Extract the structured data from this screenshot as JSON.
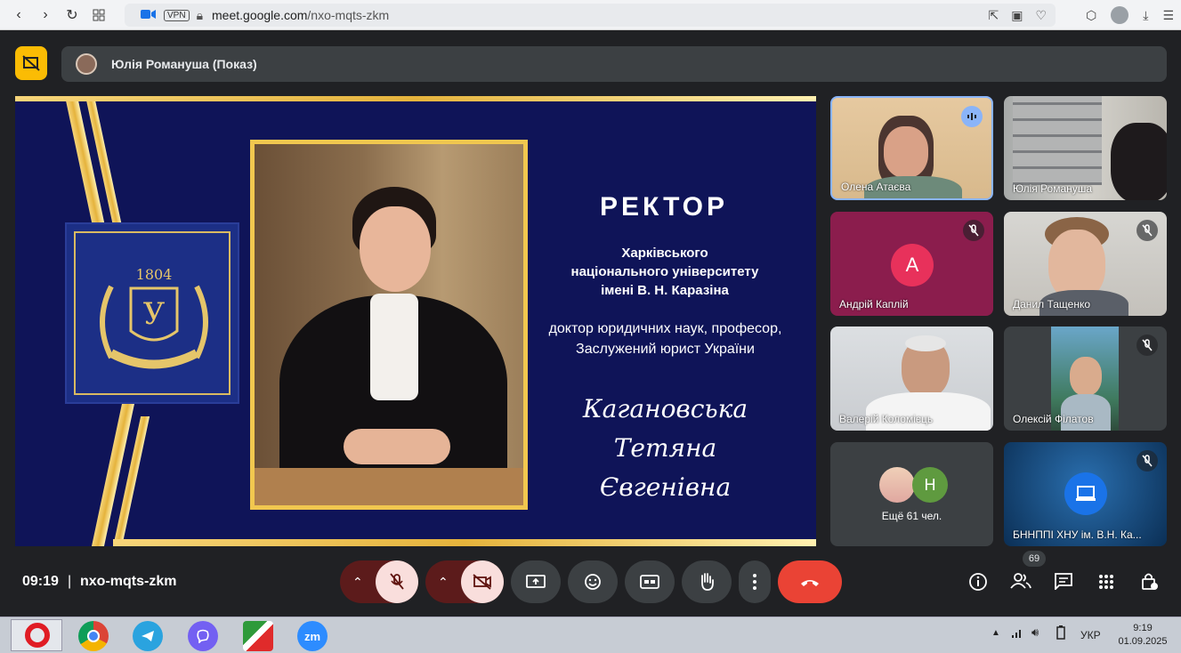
{
  "browser": {
    "url_domain": "meet.google.com",
    "url_path": "/nxo-mqts-zkm",
    "vpn_label": "VPN"
  },
  "presenting": {
    "label": "Юлія Романуша (Показ)"
  },
  "slide": {
    "title": "РЕКТОР",
    "university_lines": [
      "Харківського",
      "національного університету",
      "імені В. Н. Каразіна"
    ],
    "degree_lines": [
      "доктор юридичних наук, професор,",
      "Заслужений юрист України"
    ],
    "name_lines": [
      "Кагановська Тетяна",
      "Євгенівна"
    ],
    "logo_year": "1804",
    "logo_letter": "У"
  },
  "participants": [
    {
      "name": "Олена Атаєва",
      "speaking": true
    },
    {
      "name": "Юлія Романуша",
      "muted": false
    },
    {
      "name": "Андрій Каплій",
      "initial": "А",
      "muted": true
    },
    {
      "name": "Данил Тащенко",
      "muted": true
    },
    {
      "name": "Валерій Коломієць",
      "muted": false
    },
    {
      "name": "Олексій Філатов",
      "muted": true
    },
    {
      "name": "БННППІ ХНУ ім. В.Н. Ка...",
      "muted": true
    }
  ],
  "others": {
    "label": "Ещё 61 чел.",
    "initial": "Н"
  },
  "controls": {
    "time": "09:19",
    "meeting_code": "nxo-mqts-zkm",
    "people_count": "69"
  },
  "taskbar": {
    "lang": "УКР",
    "time": "9:19",
    "date": "01.09.2025",
    "zoom_label": "zm"
  },
  "colors": {
    "accent_yellow": "#fbbc04",
    "end_call": "#ea4335",
    "slide_bg": "#0f1458",
    "gold": "#f1c74f"
  }
}
